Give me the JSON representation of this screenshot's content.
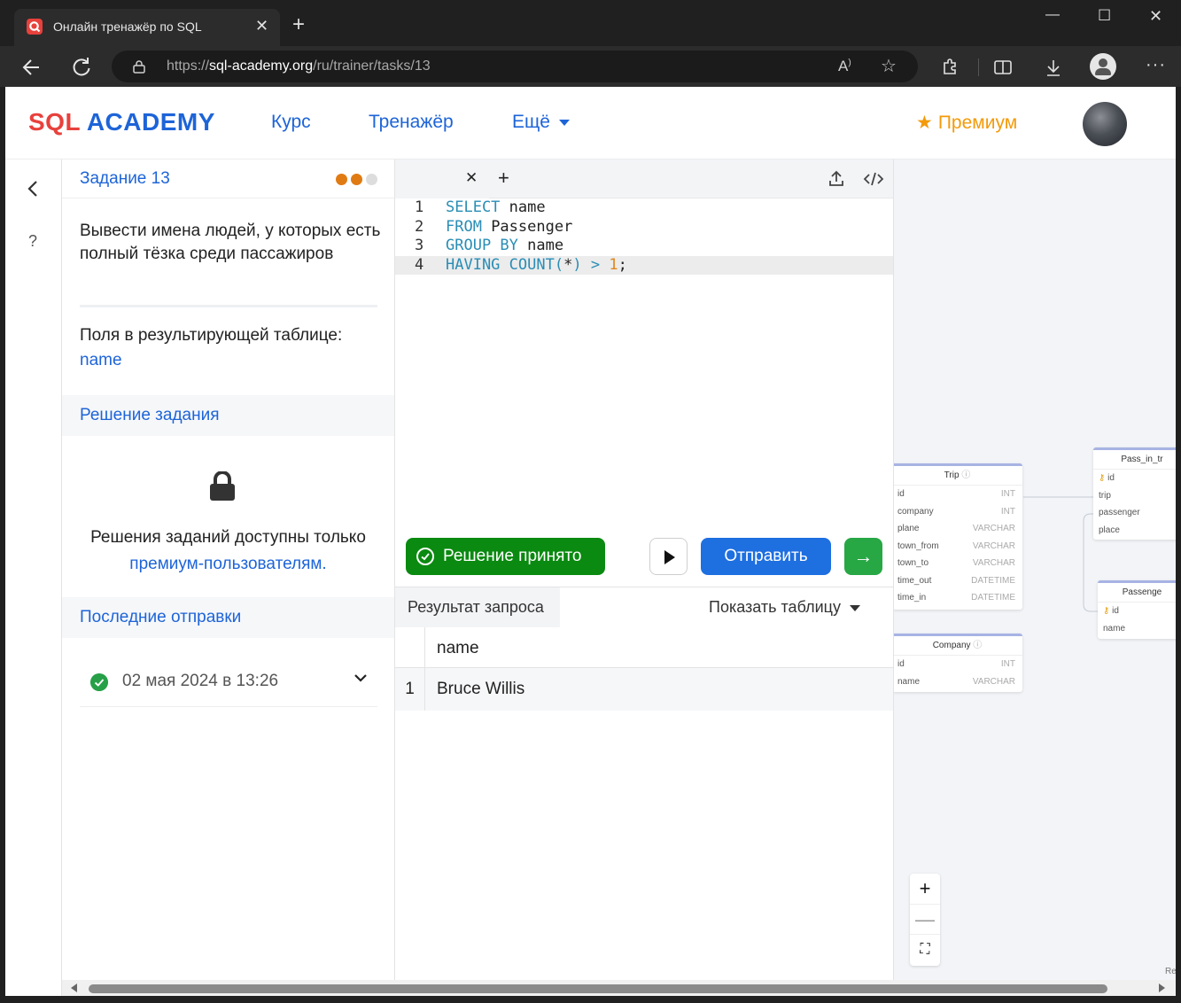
{
  "browser": {
    "tab_title": "Онлайн тренажёр по SQL",
    "url_scheme": "https://",
    "url_host": "sql-academy.org",
    "url_path": "/ru/trainer/tasks/13"
  },
  "header": {
    "logo_sql": "SQL",
    "logo_academy": "ACADEMY",
    "nav": [
      {
        "label": "Курс"
      },
      {
        "label": "Тренажёр"
      },
      {
        "label": "Ещё"
      }
    ],
    "premium_label": "Премиум"
  },
  "task": {
    "title": "Задание 13",
    "progress_colors": [
      "#e07b14",
      "#e07b14",
      "#dddddd"
    ],
    "description": "Вывести имена людей, у которых есть полный тёзка среди пассажиров",
    "result_fields_label": "Поля в результирующей таблице:",
    "result_fields_value": "name",
    "solution_section": "Решение задания",
    "premium_msg_line1": "Решения заданий доступны только",
    "premium_msg_link": "премиум-пользователям.",
    "last_submissions_section": "Последние отправки",
    "last_submission_date": "02 мая 2024 в 13:26"
  },
  "editor": {
    "code_lines": [
      {
        "num": "1",
        "tokens": [
          {
            "t": "SELECT",
            "c": "kw"
          },
          {
            "t": " name",
            "c": ""
          }
        ]
      },
      {
        "num": "2",
        "tokens": [
          {
            "t": "FROM",
            "c": "kw"
          },
          {
            "t": " Passenger",
            "c": ""
          }
        ]
      },
      {
        "num": "3",
        "tokens": [
          {
            "t": "GROUP BY",
            "c": "kw"
          },
          {
            "t": " name",
            "c": ""
          }
        ]
      },
      {
        "num": "4",
        "tokens": [
          {
            "t": "HAVING COUNT",
            "c": "kw"
          },
          {
            "t": "(",
            "c": "op"
          },
          {
            "t": "*",
            "c": ""
          },
          {
            "t": ")",
            "c": "op"
          },
          {
            "t": " ",
            "c": ""
          },
          {
            "t": ">",
            "c": "op"
          },
          {
            "t": " ",
            "c": ""
          },
          {
            "t": "1",
            "c": "num"
          },
          {
            "t": ";",
            "c": ""
          }
        ]
      }
    ],
    "accepted_label": "Решение принято",
    "send_label": "Отправить",
    "next_glyph": "→"
  },
  "results": {
    "tab_label": "Результат запроса",
    "show_table_label": "Показать таблицу",
    "column": "name",
    "rows": [
      {
        "idx": "1",
        "name": "Bruce Willis"
      }
    ]
  },
  "schema": {
    "trip": {
      "name": "Trip",
      "fields": [
        {
          "name": "id",
          "type": "INT"
        },
        {
          "name": "company",
          "type": "INT"
        },
        {
          "name": "plane",
          "type": "VARCHAR"
        },
        {
          "name": "town_from",
          "type": "VARCHAR"
        },
        {
          "name": "town_to",
          "type": "VARCHAR"
        },
        {
          "name": "time_out",
          "type": "DATETIME"
        },
        {
          "name": "time_in",
          "type": "DATETIME"
        }
      ]
    },
    "company": {
      "name": "Company",
      "fields": [
        {
          "name": "id",
          "type": "INT"
        },
        {
          "name": "name",
          "type": "VARCHAR"
        }
      ]
    },
    "pass_in_trip": {
      "name": "Pass_in_tr",
      "fields": [
        {
          "name": "id"
        },
        {
          "name": "trip"
        },
        {
          "name": "passenger"
        },
        {
          "name": "place"
        }
      ]
    },
    "passenger": {
      "name": "Passenge",
      "fields": [
        {
          "name": "id"
        },
        {
          "name": "name"
        }
      ]
    },
    "attribution": "Re"
  }
}
